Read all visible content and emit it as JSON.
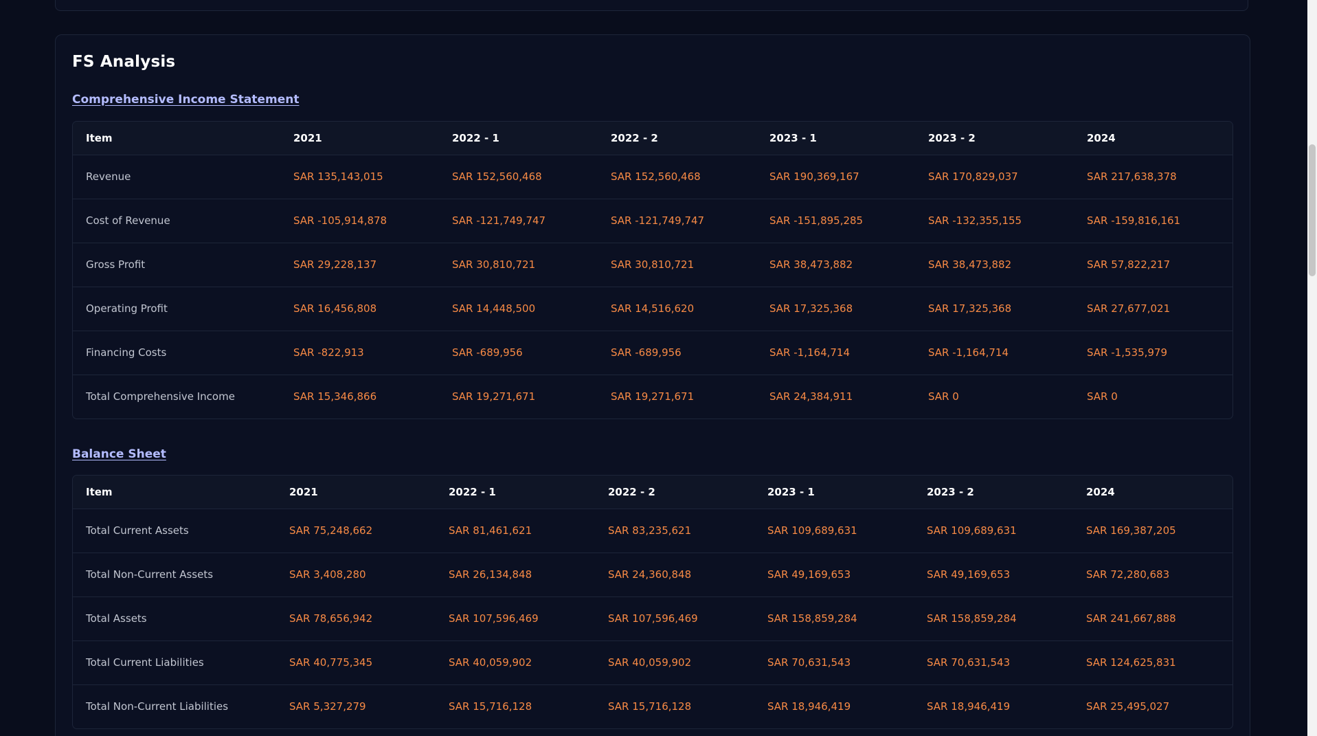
{
  "card": {
    "title": "FS Analysis"
  },
  "income": {
    "link": "Comprehensive Income Statement",
    "headers": [
      "Item",
      "2021",
      "2022 - 1",
      "2022 - 2",
      "2023 - 1",
      "2023 - 2",
      "2024"
    ],
    "rows": [
      [
        "Revenue",
        "SAR 135,143,015",
        "SAR 152,560,468",
        "SAR 152,560,468",
        "SAR 190,369,167",
        "SAR 170,829,037",
        "SAR 217,638,378"
      ],
      [
        "Cost of Revenue",
        "SAR -105,914,878",
        "SAR -121,749,747",
        "SAR -121,749,747",
        "SAR -151,895,285",
        "SAR -132,355,155",
        "SAR -159,816,161"
      ],
      [
        "Gross Profit",
        "SAR 29,228,137",
        "SAR 30,810,721",
        "SAR 30,810,721",
        "SAR 38,473,882",
        "SAR 38,473,882",
        "SAR 57,822,217"
      ],
      [
        "Operating Profit",
        "SAR 16,456,808",
        "SAR 14,448,500",
        "SAR 14,516,620",
        "SAR 17,325,368",
        "SAR 17,325,368",
        "SAR 27,677,021"
      ],
      [
        "Financing Costs",
        "SAR -822,913",
        "SAR -689,956",
        "SAR -689,956",
        "SAR -1,164,714",
        "SAR -1,164,714",
        "SAR -1,535,979"
      ],
      [
        "Total Comprehensive Income",
        "SAR 15,346,866",
        "SAR 19,271,671",
        "SAR 19,271,671",
        "SAR 24,384,911",
        "SAR 0",
        "SAR 0"
      ]
    ]
  },
  "balance": {
    "link": "Balance Sheet",
    "headers": [
      "Item",
      "2021",
      "2022 - 1",
      "2022 - 2",
      "2023 - 1",
      "2023 - 2",
      "2024"
    ],
    "rows": [
      [
        "Total Current Assets",
        "SAR 75,248,662",
        "SAR 81,461,621",
        "SAR 83,235,621",
        "SAR 109,689,631",
        "SAR 109,689,631",
        "SAR 169,387,205"
      ],
      [
        "Total Non-Current Assets",
        "SAR 3,408,280",
        "SAR 26,134,848",
        "SAR 24,360,848",
        "SAR 49,169,653",
        "SAR 49,169,653",
        "SAR 72,280,683"
      ],
      [
        "Total Assets",
        "SAR 78,656,942",
        "SAR 107,596,469",
        "SAR 107,596,469",
        "SAR 158,859,284",
        "SAR 158,859,284",
        "SAR 241,667,888"
      ],
      [
        "Total Current Liabilities",
        "SAR 40,775,345",
        "SAR 40,059,902",
        "SAR 40,059,902",
        "SAR 70,631,543",
        "SAR 70,631,543",
        "SAR 124,625,831"
      ],
      [
        "Total Non-Current Liabilities",
        "SAR 5,327,279",
        "SAR 15,716,128",
        "SAR 15,716,128",
        "SAR 18,946,419",
        "SAR 18,946,419",
        "SAR 25,495,027"
      ]
    ]
  }
}
